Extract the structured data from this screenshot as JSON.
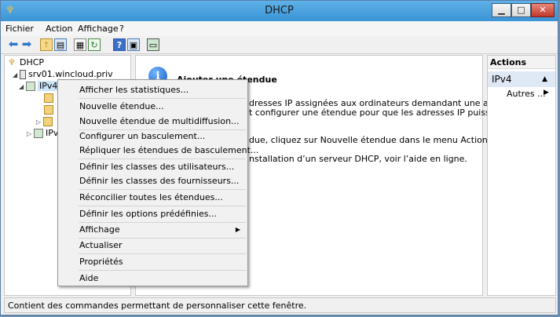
{
  "window": {
    "title": "DHCP"
  },
  "menubar": {
    "items": [
      "Fichier",
      "Action",
      "Affichage",
      "?"
    ]
  },
  "toolbar": {
    "buttons": [
      "back-icon",
      "forward-icon",
      "up-folder-icon",
      "show-pane-icon",
      "properties-icon",
      "refresh-icon",
      "help-icon",
      "view-icon",
      "monitor-icon"
    ]
  },
  "tree": {
    "root": "DHCP",
    "server": "srv01.wincloud.priv",
    "ipv4": "IPv4",
    "ipv6": "IPv6"
  },
  "details": {
    "heading": "Ajouter une étendue",
    "lines": [
      "dresses IP assignées aux ordinateurs demandant une adresse IP",
      "t configurer une étendue pour que les adresses IP puissent être",
      "due, cliquez sur Nouvelle étendue dans le menu Action.",
      "nstallation d’un serveur DHCP, voir l’aide en ligne."
    ]
  },
  "actions": {
    "header": "Actions",
    "group": "IPv4",
    "more": "Autres ..."
  },
  "context_menu": {
    "items": [
      "Afficher les statistiques...",
      "Nouvelle étendue...",
      "Nouvelle étendue de multidiffusion...",
      "Configurer un basculement...",
      "Répliquer les étendues de basculement...",
      "Définir les classes des utilisateurs...",
      "Définir les classes des fournisseurs...",
      "Réconcilier toutes les étendues...",
      "Définir les options prédéfinies...",
      "Affichage",
      "Actualiser",
      "Propriétés",
      "Aide"
    ]
  },
  "status": {
    "text": "Contient des commandes permettant de personnaliser cette fenêtre."
  },
  "colors": {
    "titlebar": "#3a93d6",
    "close": "#c0392b",
    "selection": "#dfe9f5"
  }
}
